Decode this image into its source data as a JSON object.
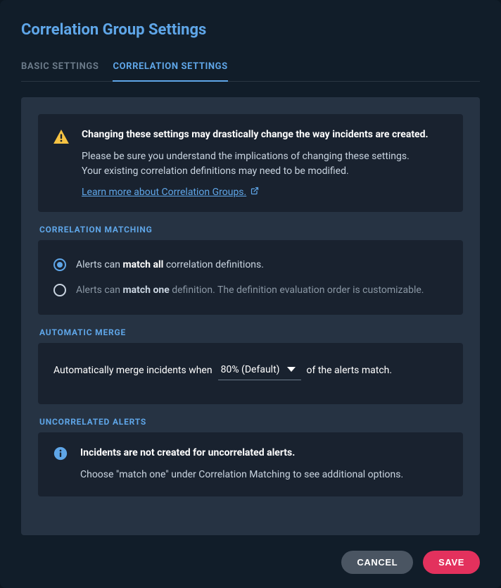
{
  "title": "Correlation Group Settings",
  "tabs": {
    "basic": "BASIC SETTINGS",
    "correlation": "CORRELATION SETTINGS"
  },
  "warning": {
    "bold": "Changing these settings may drastically change the way incidents are created.",
    "line1": "Please be sure you understand the implications of changing these settings.",
    "line2": "Your existing correlation definitions may need to be modified.",
    "link": "Learn more about Correlation Groups."
  },
  "sections": {
    "matching": {
      "label": "CORRELATION MATCHING",
      "opt1_pre": "Alerts can ",
      "opt1_bold": "match all",
      "opt1_post": " correlation definitions.",
      "opt2_pre": "Alerts can ",
      "opt2_bold": "match one",
      "opt2_post": " definition. The definition evaluation order is customizable."
    },
    "merge": {
      "label": "AUTOMATIC MERGE",
      "pre": "Automatically merge incidents when",
      "value": "80% (Default)",
      "post": "of the alerts match."
    },
    "uncorrelated": {
      "label": "UNCORRELATED ALERTS",
      "bold": "Incidents are not created for uncorrelated alerts.",
      "desc": "Choose \"match one\" under Correlation Matching to see additional options."
    }
  },
  "footer": {
    "cancel": "CANCEL",
    "save": "SAVE"
  }
}
